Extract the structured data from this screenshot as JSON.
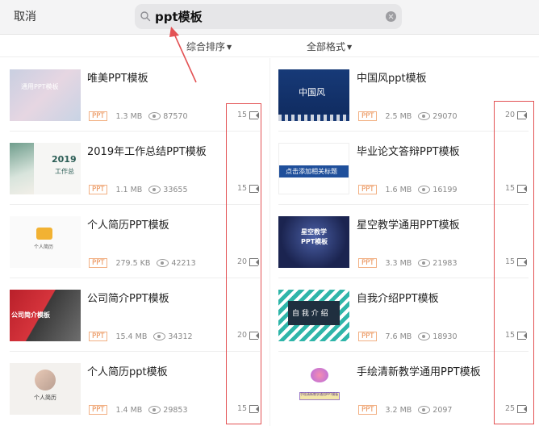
{
  "header": {
    "cancel_label": "取消",
    "search_query": "ppt模板"
  },
  "filters": {
    "sort_label": "综合排序",
    "format_label": "全部格式"
  },
  "colors": {
    "badge": "#e8884a",
    "highlight": "#e35254"
  },
  "left_items": [
    {
      "title": "唯美PPT模板",
      "badge": "PPT",
      "size": "1.3 MB",
      "views": "87570",
      "count": "15",
      "thumb_text": "通用PPT模板"
    },
    {
      "title": "2019年工作总结PPT模板",
      "badge": "PPT",
      "size": "1.1 MB",
      "views": "33655",
      "count": "15",
      "thumb_text": "2019",
      "thumb_text2": "工作总"
    },
    {
      "title": "个人简历PPT模板",
      "badge": "PPT",
      "size": "279.5 KB",
      "views": "42213",
      "count": "20",
      "thumb_text": "个人简历"
    },
    {
      "title": "公司简介PPT模板",
      "badge": "PPT",
      "size": "15.4 MB",
      "views": "34312",
      "count": "20",
      "thumb_text": "公司简介模板"
    },
    {
      "title": "个人简历ppt模板",
      "badge": "PPT",
      "size": "1.4 MB",
      "views": "29853",
      "count": "15",
      "thumb_text": "个人简历"
    }
  ],
  "right_items": [
    {
      "title": "中国风ppt模板",
      "badge": "PPT",
      "size": "2.5 MB",
      "views": "29070",
      "count": "20",
      "thumb_text": "中国风"
    },
    {
      "title": "毕业论文答辩PPT模板",
      "badge": "PPT",
      "size": "1.6 MB",
      "views": "16199",
      "count": "15",
      "thumb_text": "点击添加相关标题"
    },
    {
      "title": "星空教学通用PPT模板",
      "badge": "PPT",
      "size": "3.3 MB",
      "views": "21983",
      "count": "15",
      "thumb_text": "星空教学",
      "thumb_text2": "PPT模板"
    },
    {
      "title": "自我介绍PPT模板",
      "badge": "PPT",
      "size": "7.6 MB",
      "views": "18930",
      "count": "15",
      "thumb_text": "自 我 介 绍"
    },
    {
      "title": "手绘清新教学通用PPT模板",
      "badge": "PPT",
      "size": "3.2 MB",
      "views": "2097",
      "count": "25",
      "thumb_text": "手绘清新教学通用PPT模板"
    }
  ]
}
